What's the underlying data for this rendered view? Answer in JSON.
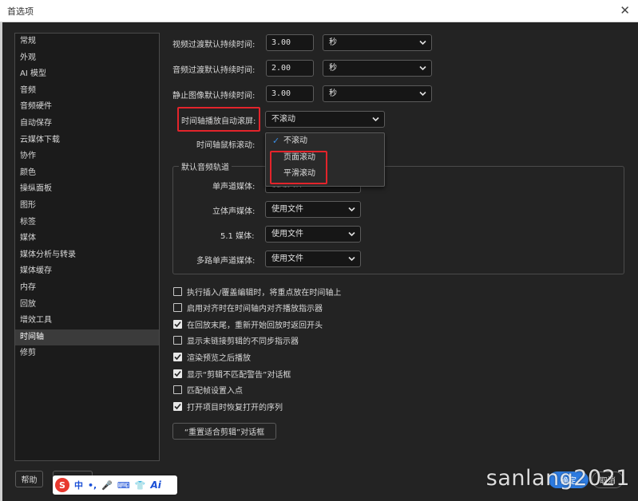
{
  "window": {
    "title": "首选项",
    "close_icon": "close-icon"
  },
  "sidebar": {
    "items": [
      {
        "label": "常规"
      },
      {
        "label": "外观"
      },
      {
        "label": "AI 模型"
      },
      {
        "label": "音频"
      },
      {
        "label": "音频硬件"
      },
      {
        "label": "自动保存"
      },
      {
        "label": "云媒体下载"
      },
      {
        "label": "协作"
      },
      {
        "label": "颜色"
      },
      {
        "label": "操纵面板"
      },
      {
        "label": "图形"
      },
      {
        "label": "标签"
      },
      {
        "label": "媒体"
      },
      {
        "label": "媒体分析与转录"
      },
      {
        "label": "媒体缓存"
      },
      {
        "label": "内存"
      },
      {
        "label": "回放"
      },
      {
        "label": "增效工具"
      },
      {
        "label": "时间轴"
      },
      {
        "label": "修剪"
      }
    ],
    "active_index": 18
  },
  "timing": [
    {
      "label": "视频过渡默认持续时间:",
      "value": "3.00",
      "unit": "秒"
    },
    {
      "label": "音频过渡默认持续时间:",
      "value": "2.00",
      "unit": "秒"
    },
    {
      "label": "静止图像默认持续时间:",
      "value": "3.00",
      "unit": "秒"
    }
  ],
  "autoscroll": {
    "label": "时间轴播放自动滚屏:",
    "value": "不滚动",
    "options": [
      {
        "label": "不滚动",
        "selected": true
      },
      {
        "label": "页面滚动",
        "selected": false
      },
      {
        "label": "平滑滚动",
        "selected": false
      }
    ]
  },
  "mousescroll": {
    "label": "时间轴鼠标滚动:"
  },
  "audio_tracks": {
    "title": "默认音频轨道",
    "rows": [
      {
        "label": "单声道媒体:",
        "value": "使用文件"
      },
      {
        "label": "立体声媒体:",
        "value": "使用文件"
      },
      {
        "label": "5.1 媒体:",
        "value": "使用文件"
      },
      {
        "label": "多路单声道媒体:",
        "value": "使用文件"
      }
    ]
  },
  "checkboxes": [
    {
      "label": "执行插入/覆盖编辑时，将重点放在时间轴上",
      "checked": false
    },
    {
      "label": "启用对齐时在时间轴内对齐播放指示器",
      "checked": false
    },
    {
      "label": "在回放末尾，重新开始回放时返回开头",
      "checked": true
    },
    {
      "label": "显示未链接剪辑的不同步指示器",
      "checked": false
    },
    {
      "label": "渲染预览之后播放",
      "checked": true
    },
    {
      "label": "显示“剪辑不匹配警告”对话框",
      "checked": true
    },
    {
      "label": "匹配帧设置入点",
      "checked": false
    },
    {
      "label": "打开项目时恢复打开的序列",
      "checked": true
    }
  ],
  "reset_button": "“重置适合剪辑”对话框",
  "footer": {
    "help": "帮助",
    "ok": "确定",
    "cancel": "取消"
  },
  "ime": {
    "zh": "中",
    "punct": "•,",
    "ai": "Ai"
  },
  "watermark": "sanlang2021",
  "colors": {
    "accent": "#2d7be0",
    "highlight_box": "#e3242b",
    "background": "#232323"
  }
}
